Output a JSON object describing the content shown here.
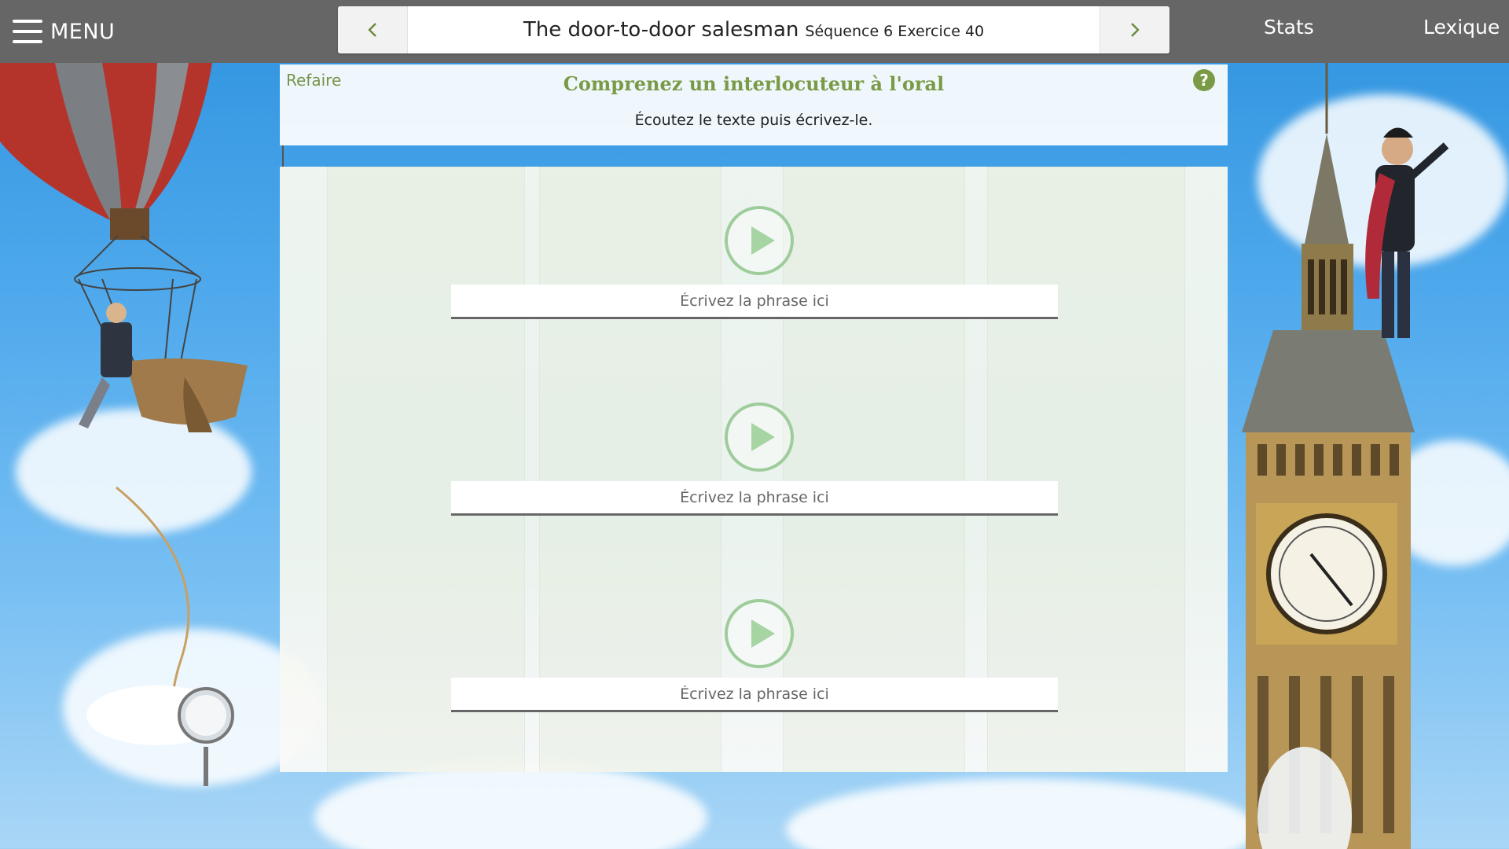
{
  "topbar": {
    "menu_label": "MENU",
    "title": "The door-to-door salesman",
    "subtitle": "Séquence 6 Exercice 40",
    "prev_icon": "chevron-left-icon",
    "next_icon": "chevron-right-icon",
    "stats_label": "Stats",
    "lexique_label": "Lexique"
  },
  "exercise": {
    "refaire_label": "Refaire",
    "help_symbol": "?",
    "title": "Comprenez un interlocuteur à l'oral",
    "instruction": "Écoutez le texte puis écrivez-le."
  },
  "items": [
    {
      "play_icon": "play-icon",
      "placeholder": "Écrivez la phrase ici",
      "value": ""
    },
    {
      "play_icon": "play-icon",
      "placeholder": "Écrivez la phrase ici",
      "value": ""
    },
    {
      "play_icon": "play-icon",
      "placeholder": "Écrivez la phrase ici",
      "value": ""
    }
  ],
  "colors": {
    "topbar": "#666666",
    "accent_green": "#7a9a45",
    "play_green": "#9ecc9b",
    "sky": "#4fa9ec"
  }
}
